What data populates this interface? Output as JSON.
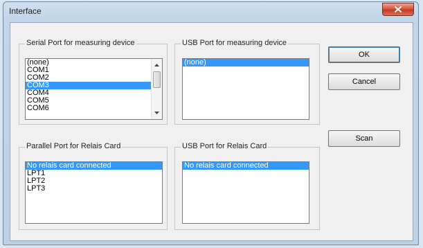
{
  "window": {
    "title": "Interface"
  },
  "serial_group": {
    "label": "Serial Port for measuring device",
    "items": [
      "(none)",
      "COM1",
      "COM2",
      "COM3",
      "COM4",
      "COM5",
      "COM6"
    ],
    "selected_index": 3
  },
  "usb_device_group": {
    "label": "USB Port for measuring device",
    "items": [
      "(none)"
    ],
    "selected_index": 0
  },
  "parallel_group": {
    "label": "Parallel Port for Relais Card",
    "items": [
      "No relais card connected",
      "LPT1",
      "LPT2",
      "LPT3"
    ],
    "selected_index": 0
  },
  "usb_relais_group": {
    "label": "USB Port for Relais Card",
    "items": [
      "No relais card connected"
    ],
    "selected_index": 0
  },
  "buttons": {
    "ok": "OK",
    "cancel": "Cancel",
    "scan": "Scan"
  },
  "colors": {
    "selection": "#3399ff",
    "close_button": "#c9452c"
  }
}
